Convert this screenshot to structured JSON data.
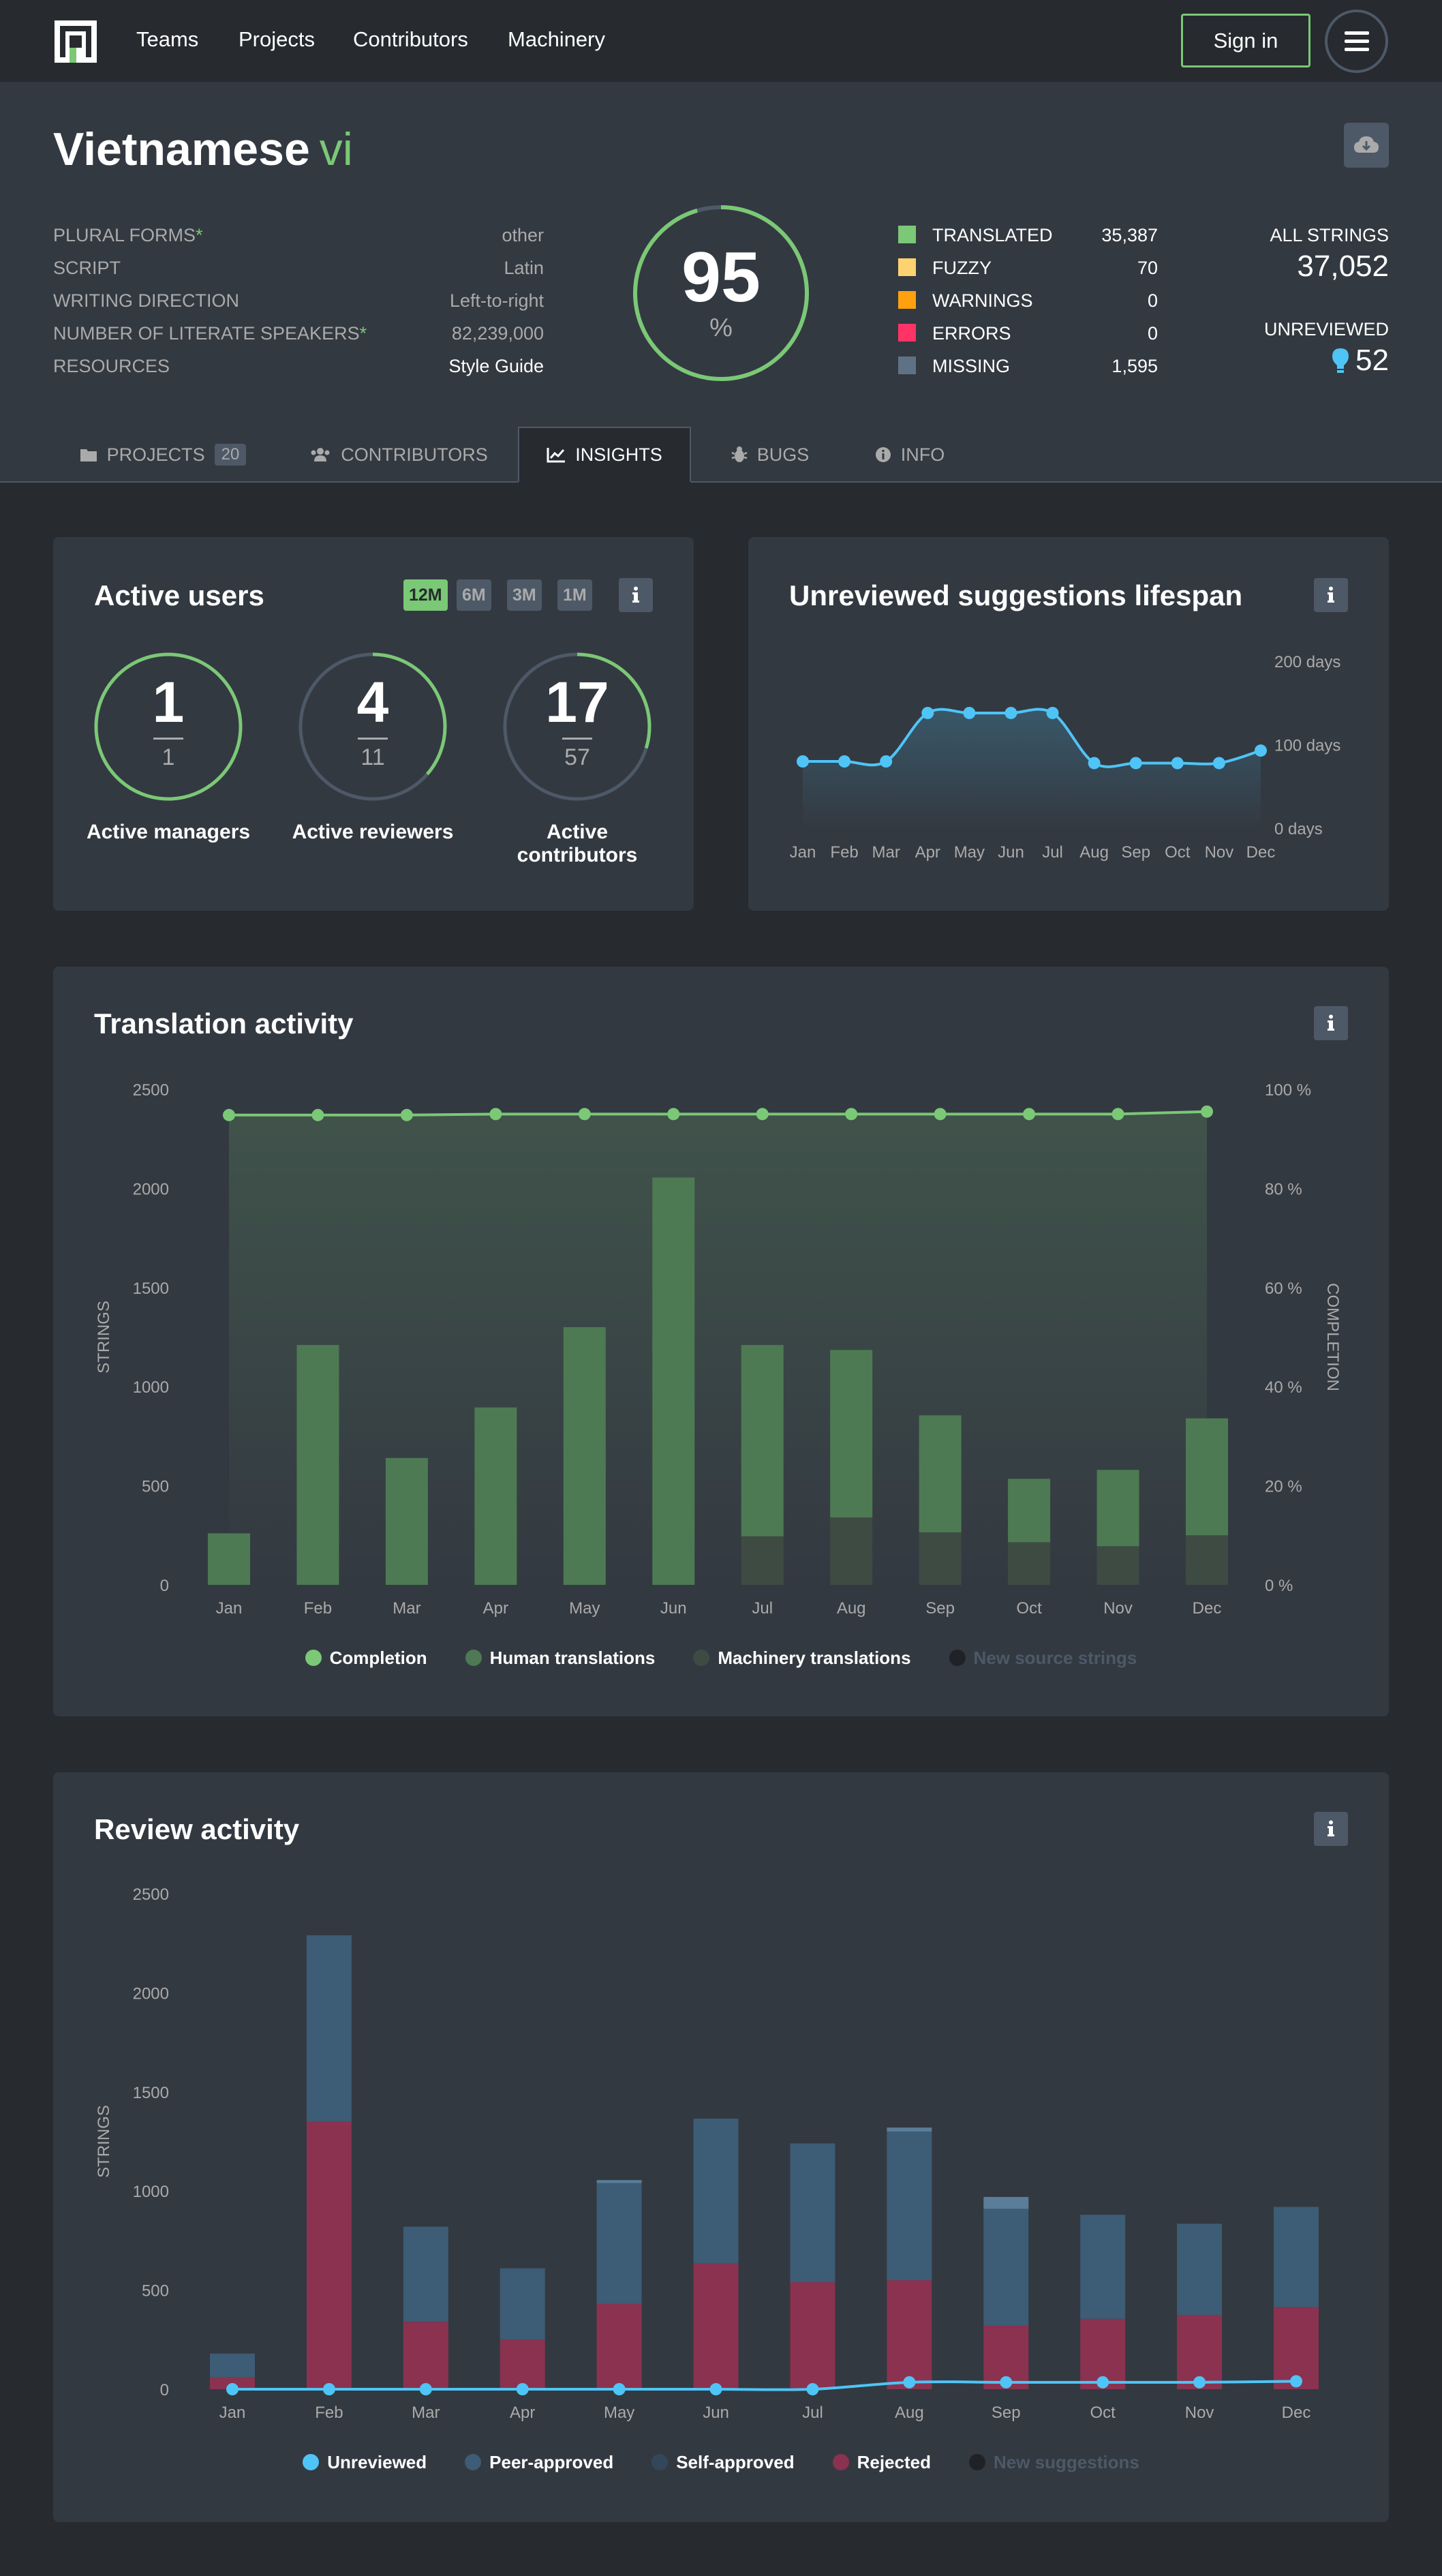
{
  "nav": {
    "links": [
      "Teams",
      "Projects",
      "Contributors",
      "Machinery"
    ],
    "sign_in": "Sign in"
  },
  "locale": {
    "name": "Vietnamese",
    "code": "vi",
    "meta": [
      {
        "label": "PLURAL FORMS",
        "asterisk": "*",
        "value": "other"
      },
      {
        "label": "SCRIPT",
        "asterisk": "",
        "value": "Latin"
      },
      {
        "label": "WRITING DIRECTION",
        "asterisk": "",
        "value": "Left-to-right"
      },
      {
        "label": "NUMBER OF LITERATE SPEAKERS",
        "asterisk": "*",
        "value": "82,239,000"
      },
      {
        "label": "RESOURCES",
        "asterisk": "",
        "value": "Style Guide"
      }
    ],
    "progress": {
      "value": "95",
      "unit": "%",
      "fraction": 0.955
    },
    "legend": [
      {
        "label": "TRANSLATED",
        "value": "35,387",
        "color": "#7bc876"
      },
      {
        "label": "FUZZY",
        "value": "70",
        "color": "#fed271"
      },
      {
        "label": "WARNINGS",
        "value": "0",
        "color": "#ffa10f"
      },
      {
        "label": "ERRORS",
        "value": "0",
        "color": "#f36"
      },
      {
        "label": "MISSING",
        "value": "1,595",
        "color": "#5f7285"
      }
    ],
    "summary": {
      "all_label": "ALL STRINGS",
      "all_value": "37,052",
      "unreviewed_label": "UNREVIEWED",
      "unreviewed_value": "52"
    }
  },
  "tabs": [
    {
      "label": "PROJECTS",
      "count": "20",
      "icon": "folder-icon"
    },
    {
      "label": "CONTRIBUTORS",
      "count": "",
      "icon": "users-icon"
    },
    {
      "label": "INSIGHTS",
      "count": "",
      "icon": "chart-icon",
      "active": true
    },
    {
      "label": "BUGS",
      "count": "",
      "icon": "bug-icon"
    },
    {
      "label": "INFO",
      "count": "",
      "icon": "info-icon"
    }
  ],
  "active_users": {
    "title": "Active users",
    "periods": [
      "12M",
      "6M",
      "3M",
      "1M"
    ],
    "active_period": "12M",
    "stats": [
      {
        "active": "1",
        "total": "1",
        "label": "Active managers",
        "fraction": 1.0
      },
      {
        "active": "4",
        "total": "11",
        "label": "Active reviewers",
        "fraction": 0.364
      },
      {
        "active": "17",
        "total": "57",
        "label": "Active contributors",
        "fraction": 0.298
      }
    ]
  },
  "lifespan": {
    "title": "Unreviewed suggestions lifespan",
    "y_ticks": [
      "200 days",
      "100 days",
      "0 days"
    ]
  },
  "translation_activity": {
    "title": "Translation activity",
    "legend": [
      {
        "label": "Completion",
        "color": "#7bc876",
        "active": true
      },
      {
        "label": "Human translations",
        "color": "#4d7a53",
        "active": true
      },
      {
        "label": "Machinery translations",
        "color": "#3e4b42",
        "active": true
      },
      {
        "label": "New source strings",
        "color": "#1f2226",
        "active": false
      }
    ]
  },
  "review_activity": {
    "title": "Review activity",
    "legend": [
      {
        "label": "Unreviewed",
        "color": "#4fc4f6",
        "active": true
      },
      {
        "label": "Peer-approved",
        "color": "#3d5c75",
        "active": true
      },
      {
        "label": "Self-approved",
        "color": "#34475a",
        "active": true
      },
      {
        "label": "Rejected",
        "color": "#8a324f",
        "active": true
      },
      {
        "label": "New suggestions",
        "color": "#1f2226",
        "active": false
      }
    ]
  },
  "chart_data": [
    {
      "type": "line",
      "title": "Unreviewed suggestions lifespan",
      "x": [
        "Jan",
        "Feb",
        "Mar",
        "Apr",
        "May",
        "Jun",
        "Jul",
        "Aug",
        "Sep",
        "Oct",
        "Nov",
        "Dec"
      ],
      "series": [
        {
          "name": "",
          "values": [
            80,
            80,
            80,
            138,
            138,
            138,
            138,
            78,
            78,
            78,
            78,
            93
          ],
          "color": "#4fc4f6"
        }
      ],
      "ylim": [
        0,
        200
      ],
      "y_ticks": [
        0,
        100,
        200
      ],
      "y_tick_suffix": " days",
      "grid": false
    },
    {
      "type": "bar",
      "title": "Translation activity",
      "categories": [
        "Jan",
        "Feb",
        "Mar",
        "Apr",
        "May",
        "Jun",
        "Jul",
        "Aug",
        "Sep",
        "Oct",
        "Nov",
        "Dec"
      ],
      "ylabel": "STRINGS",
      "y2label": "COMPLETION",
      "ylim": [
        0,
        2500
      ],
      "y_ticks": [
        0,
        500,
        1000,
        1500,
        2000,
        2500
      ],
      "y2lim": [
        0,
        100
      ],
      "y2_ticks": [
        0,
        20,
        40,
        60,
        80,
        100
      ],
      "y2_tick_suffix": " %",
      "series": [
        {
          "name": "Human translations",
          "values": [
            260,
            1210,
            640,
            895,
            1300,
            2055,
            965,
            845,
            590,
            320,
            385,
            590
          ],
          "color": "#4d7a53"
        },
        {
          "name": "Machinery translations",
          "values": [
            0,
            0,
            0,
            0,
            0,
            0,
            245,
            340,
            265,
            215,
            195,
            250
          ],
          "color": "#3e4b42"
        },
        {
          "name": "Completion",
          "type": "line",
          "axis": "y2",
          "values": [
            94.8,
            94.8,
            94.8,
            95.0,
            95.0,
            95.0,
            95.0,
            95.0,
            95.0,
            95.0,
            95.0,
            95.5
          ],
          "color": "#7bc876"
        }
      ],
      "grid": false
    },
    {
      "type": "bar",
      "title": "Review activity",
      "categories": [
        "Jan",
        "Feb",
        "Mar",
        "Apr",
        "May",
        "Jun",
        "Jul",
        "Aug",
        "Sep",
        "Oct",
        "Nov",
        "Dec"
      ],
      "ylabel": "STRINGS",
      "ylim": [
        0,
        2500
      ],
      "y_ticks": [
        0,
        500,
        1000,
        1500,
        2000,
        2500
      ],
      "series": [
        {
          "name": "Rejected",
          "values": [
            60,
            1350,
            340,
            250,
            430,
            635,
            540,
            550,
            320,
            355,
            375,
            415
          ],
          "color": "#8a324f"
        },
        {
          "name": "Self-approved",
          "values": [
            120,
            940,
            480,
            360,
            610,
            730,
            700,
            750,
            590,
            525,
            460,
            505
          ],
          "color": "#3d5c75"
        },
        {
          "name": "Peer-approved",
          "values": [
            0,
            0,
            0,
            0,
            15,
            0,
            0,
            20,
            60,
            0,
            0,
            0
          ],
          "color": "#5a7d99"
        },
        {
          "name": "Unreviewed",
          "type": "line",
          "values": [
            0,
            0,
            0,
            0,
            0,
            0,
            0,
            35,
            35,
            35,
            35,
            40
          ],
          "color": "#4fc4f6"
        }
      ],
      "grid": false
    }
  ]
}
